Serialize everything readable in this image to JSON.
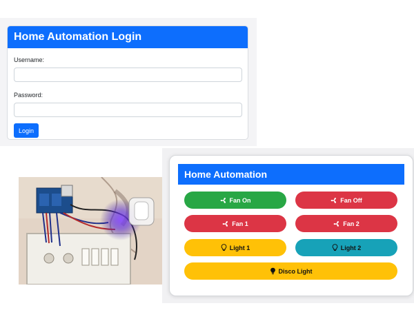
{
  "login": {
    "title": "Home Automation Login",
    "username_label": "Username:",
    "username_value": "",
    "password_label": "Password:",
    "password_value": "",
    "login_button": "Login"
  },
  "panel": {
    "title": "Home Automation",
    "buttons": {
      "fan_on": {
        "label": "Fan On",
        "icon": "fan-icon",
        "color": "#28a745"
      },
      "fan_off": {
        "label": "Fan Off",
        "icon": "fan-icon",
        "color": "#dc3545"
      },
      "fan_1": {
        "label": "Fan 1",
        "icon": "fan-icon",
        "color": "#dc3545"
      },
      "fan_2": {
        "label": "Fan 2",
        "icon": "fan-icon",
        "color": "#dc3545"
      },
      "light_1": {
        "label": "Light 1",
        "icon": "lightbulb-outline-icon",
        "color": "#ffc107"
      },
      "light_2": {
        "label": "Light 2",
        "icon": "lightbulb-outline-icon",
        "color": "#17a2b8"
      },
      "disco_light": {
        "label": "Disco Light",
        "icon": "lightbulb-filled-icon",
        "color": "#ffc107"
      }
    }
  },
  "colors": {
    "primary": "#0d6efd",
    "success": "#28a745",
    "danger": "#dc3545",
    "warning": "#ffc107",
    "info": "#17a2b8"
  }
}
